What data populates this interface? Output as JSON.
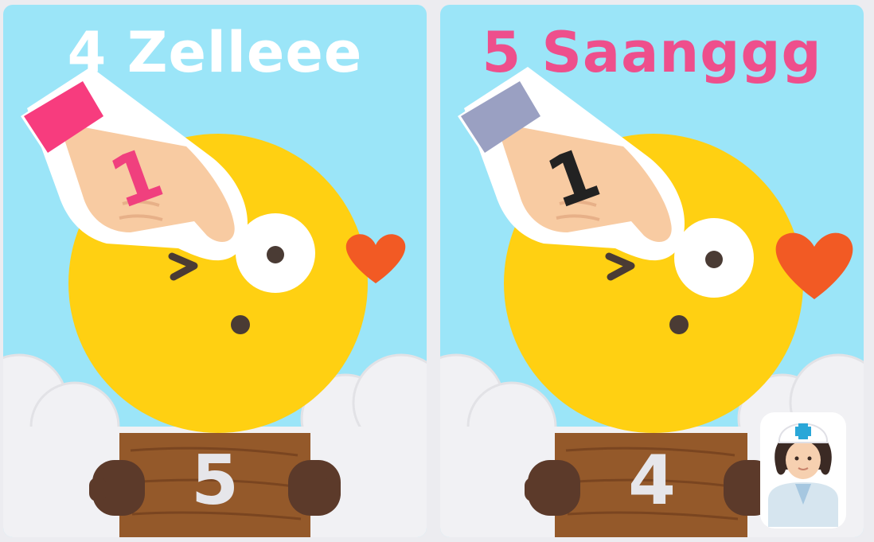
{
  "players": [
    {
      "name": "4 Zelleee",
      "name_color": "#ffffff",
      "board_number": "5",
      "finger_number": "1",
      "finger_number_color": "#f0407e",
      "sleeve_color": "#f73c7e",
      "role_icon": null
    },
    {
      "name": "5 Saanggg",
      "name_color": "#ee4f8c",
      "board_number": "4",
      "finger_number": "1",
      "finger_number_color": "#222222",
      "sleeve_color": "#9aa0c2",
      "role_icon": "nurse-icon"
    }
  ],
  "colors": {
    "sky": "#9be5f8",
    "chick": "#ffd012",
    "beak": "#f25a24",
    "board": "#94592a",
    "hands": "#5c3a2a",
    "cloud": "#f1f1f4"
  }
}
